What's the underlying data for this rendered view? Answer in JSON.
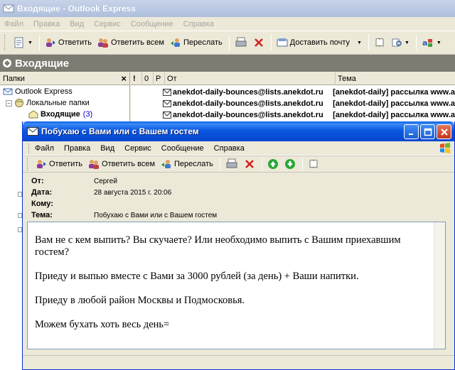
{
  "main_window": {
    "title": "Входящие - Outlook Express",
    "menu": [
      "Файл",
      "Правка",
      "Вид",
      "Сервис",
      "Сообщение",
      "Справка"
    ],
    "toolbar": {
      "reply": "Ответить",
      "reply_all": "Ответить всем",
      "forward": "Переслать",
      "deliver": "Доставить почту"
    },
    "folder_bar_title": "Входящие"
  },
  "folders_pane": {
    "header": "Папки",
    "close": "×",
    "root": "Outlook Express",
    "local": "Локальные папки",
    "inbox": "Входящие",
    "inbox_count": "(3)"
  },
  "message_list": {
    "columns": [
      "!",
      "0",
      "Р",
      "От",
      "Тема"
    ],
    "rows": [
      {
        "from": "anekdot-daily-bounces@lists.anekdot.ru",
        "subject": "[anekdot-daily] рассылка www.a"
      },
      {
        "from": "anekdot-daily-bounces@lists.anekdot.ru",
        "subject": "[anekdot-daily] рассылка www.a"
      },
      {
        "from": "anekdot-daily-bounces@lists.anekdot.ru",
        "subject": "[anekdot-daily] рассылка www.a"
      }
    ]
  },
  "message_window": {
    "title": "Побухаю с Вами или с Вашем гостем",
    "menu": [
      "Файл",
      "Правка",
      "Вид",
      "Сервис",
      "Сообщение",
      "Справка"
    ],
    "toolbar": {
      "reply": "Ответить",
      "reply_all": "Ответить всем",
      "forward": "Переслать"
    },
    "headers": {
      "from_label": "От:",
      "from_value": "Сергей",
      "date_label": "Дата:",
      "date_value": "28 августа 2015 г. 20:06",
      "to_label": "Кому:",
      "to_value": "",
      "subject_label": "Тема:",
      "subject_value": "Побухаю с Вами или с Вашем гостем"
    },
    "body": [
      "Вам не с кем выпить? Вы скучаете? Или необходимо выпить с Вашим приехавшим гостем?",
      "Приеду и выпью вместе с Вами за 3000 рублей (за день) + Ваши напитки.",
      "Приеду в любой район Москвы и Подмосковья.",
      "Можем бухать хоть весь день="
    ]
  },
  "colors": {
    "xp_title_blue": "#0b58e0",
    "close_red": "#c2361b",
    "toolbar_bg": "#ece9d8",
    "folder_bar": "#7d7b72"
  }
}
